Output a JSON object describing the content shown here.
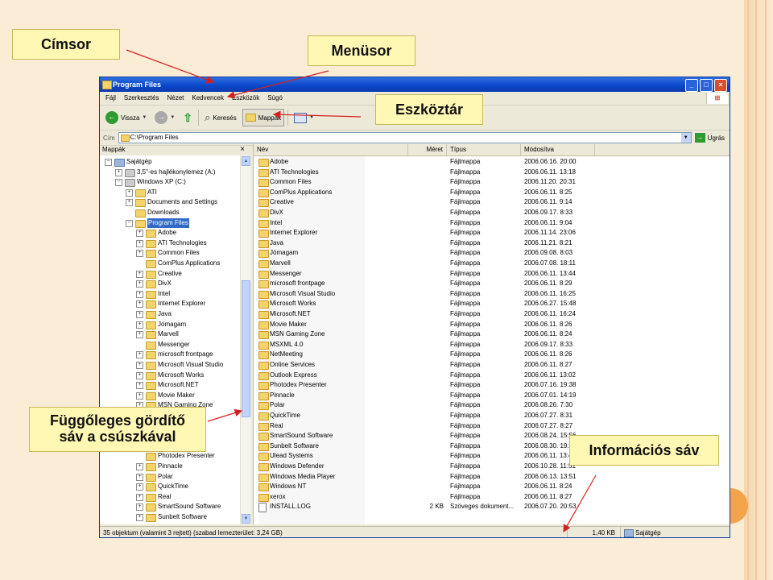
{
  "callouts": {
    "title_bar": "Címsor",
    "menu_bar": "Menüsor",
    "toolbar": "Eszköztár",
    "vertical_scroll_line1": "Függőleges gördítő",
    "vertical_scroll_line2": "sáv a csúszkával",
    "status_bar": "Információs sáv"
  },
  "window": {
    "title": "Program Files",
    "menu": [
      "Fájl",
      "Szerkesztés",
      "Nézet",
      "Kedvencek",
      "Eszközök",
      "Súgó"
    ],
    "toolbar": {
      "back": "Vissza",
      "search": "Keresés",
      "folders": "Mappák"
    },
    "address": {
      "label": "Cím",
      "value": "C:\\Program Files",
      "go": "Ugrás"
    },
    "folders_pane": {
      "title": "Mappák",
      "items": [
        {
          "label": "Sajátgép",
          "indent": 0,
          "expander": "−",
          "icon": "computer"
        },
        {
          "label": "3,5\"-es hajlékonylemez (A:)",
          "indent": 1,
          "expander": "+",
          "icon": "drive"
        },
        {
          "label": "Windows XP (C:)",
          "indent": 1,
          "expander": "−",
          "icon": "drive"
        },
        {
          "label": "ATI",
          "indent": 2,
          "expander": "+",
          "icon": "folder"
        },
        {
          "label": "Documents and Settings",
          "indent": 2,
          "expander": "+",
          "icon": "folder"
        },
        {
          "label": "Downloads",
          "indent": 2,
          "expander": "",
          "icon": "folder"
        },
        {
          "label": "Program Files",
          "indent": 2,
          "expander": "−",
          "icon": "folder",
          "selected": true
        },
        {
          "label": "Adobe",
          "indent": 3,
          "expander": "+",
          "icon": "folder"
        },
        {
          "label": "ATI Technologies",
          "indent": 3,
          "expander": "+",
          "icon": "folder"
        },
        {
          "label": "Common Files",
          "indent": 3,
          "expander": "+",
          "icon": "folder"
        },
        {
          "label": "ComPlus Applications",
          "indent": 3,
          "expander": "",
          "icon": "folder"
        },
        {
          "label": "Creative",
          "indent": 3,
          "expander": "+",
          "icon": "folder"
        },
        {
          "label": "DivX",
          "indent": 3,
          "expander": "+",
          "icon": "folder"
        },
        {
          "label": "Intel",
          "indent": 3,
          "expander": "+",
          "icon": "folder"
        },
        {
          "label": "Internet Explorer",
          "indent": 3,
          "expander": "+",
          "icon": "folder"
        },
        {
          "label": "Java",
          "indent": 3,
          "expander": "+",
          "icon": "folder"
        },
        {
          "label": "Jómagam",
          "indent": 3,
          "expander": "+",
          "icon": "folder"
        },
        {
          "label": "Marvell",
          "indent": 3,
          "expander": "+",
          "icon": "folder"
        },
        {
          "label": "Messenger",
          "indent": 3,
          "expander": "",
          "icon": "folder"
        },
        {
          "label": "microsoft frontpage",
          "indent": 3,
          "expander": "+",
          "icon": "folder"
        },
        {
          "label": "Microsoft Visual Studio",
          "indent": 3,
          "expander": "+",
          "icon": "folder"
        },
        {
          "label": "Microsoft Works",
          "indent": 3,
          "expander": "+",
          "icon": "folder"
        },
        {
          "label": "Microsoft.NET",
          "indent": 3,
          "expander": "+",
          "icon": "folder"
        },
        {
          "label": "Movie Maker",
          "indent": 3,
          "expander": "+",
          "icon": "folder"
        },
        {
          "label": "MSN Gaming Zone",
          "indent": 3,
          "expander": "+",
          "icon": "folder"
        },
        {
          "label": "MSXML 4.0",
          "indent": 3,
          "expander": "+",
          "icon": "folder"
        },
        {
          "label": "NetMeeting",
          "indent": 3,
          "expander": "+",
          "icon": "folder"
        },
        {
          "label": "Online Services",
          "indent": 3,
          "expander": "+",
          "icon": "folder"
        },
        {
          "label": "Outlook Express",
          "indent": 3,
          "expander": "+",
          "icon": "folder"
        },
        {
          "label": "Photodex Presenter",
          "indent": 3,
          "expander": "",
          "icon": "folder"
        },
        {
          "label": "Pinnacle",
          "indent": 3,
          "expander": "+",
          "icon": "folder"
        },
        {
          "label": "Polar",
          "indent": 3,
          "expander": "+",
          "icon": "folder"
        },
        {
          "label": "QuickTime",
          "indent": 3,
          "expander": "+",
          "icon": "folder"
        },
        {
          "label": "Real",
          "indent": 3,
          "expander": "+",
          "icon": "folder"
        },
        {
          "label": "SmartSound Software",
          "indent": 3,
          "expander": "+",
          "icon": "folder"
        },
        {
          "label": "Sunbelt Software",
          "indent": 3,
          "expander": "+",
          "icon": "folder"
        }
      ]
    },
    "file_list": {
      "columns": {
        "name": "Név",
        "size": "Méret",
        "type": "Típus",
        "modified": "Módosítva"
      },
      "rows": [
        {
          "name": "Adobe",
          "size": "",
          "type": "Fájlmappa",
          "modified": "2006.06.16. 20:00"
        },
        {
          "name": "ATI Technologies",
          "size": "",
          "type": "Fájlmappa",
          "modified": "2006.06.11. 13:18"
        },
        {
          "name": "Common Files",
          "size": "",
          "type": "Fájlmappa",
          "modified": "2006.11.20. 20:31"
        },
        {
          "name": "ComPlus Applications",
          "size": "",
          "type": "Fájlmappa",
          "modified": "2006.06.11. 8:25"
        },
        {
          "name": "Creative",
          "size": "",
          "type": "Fájlmappa",
          "modified": "2006.06.11. 9:14"
        },
        {
          "name": "DivX",
          "size": "",
          "type": "Fájlmappa",
          "modified": "2006.09.17. 8:33"
        },
        {
          "name": "Intel",
          "size": "",
          "type": "Fájlmappa",
          "modified": "2006.06.11. 9:04"
        },
        {
          "name": "Internet Explorer",
          "size": "",
          "type": "Fájlmappa",
          "modified": "2006.11.14. 23:06"
        },
        {
          "name": "Java",
          "size": "",
          "type": "Fájlmappa",
          "modified": "2006.11.21. 8:21"
        },
        {
          "name": "Jómagam",
          "size": "",
          "type": "Fájlmappa",
          "modified": "2006.09.08. 8:03"
        },
        {
          "name": "Marvell",
          "size": "",
          "type": "Fájlmappa",
          "modified": "2006.07.08. 18:11"
        },
        {
          "name": "Messenger",
          "size": "",
          "type": "Fájlmappa",
          "modified": "2006.06.11. 13:44"
        },
        {
          "name": "microsoft frontpage",
          "size": "",
          "type": "Fájlmappa",
          "modified": "2006.06.11. 8:29"
        },
        {
          "name": "Microsoft Visual Studio",
          "size": "",
          "type": "Fájlmappa",
          "modified": "2006.06.11. 16:25"
        },
        {
          "name": "Microsoft Works",
          "size": "",
          "type": "Fájlmappa",
          "modified": "2006.06.27. 15:48"
        },
        {
          "name": "Microsoft.NET",
          "size": "",
          "type": "Fájlmappa",
          "modified": "2006.06.11. 16:24"
        },
        {
          "name": "Movie Maker",
          "size": "",
          "type": "Fájlmappa",
          "modified": "2006.06.11. 8:26"
        },
        {
          "name": "MSN Gaming Zone",
          "size": "",
          "type": "Fájlmappa",
          "modified": "2006.06.11. 8:24"
        },
        {
          "name": "MSXML 4.0",
          "size": "",
          "type": "Fájlmappa",
          "modified": "2006.09.17. 8:33"
        },
        {
          "name": "NetMeeting",
          "size": "",
          "type": "Fájlmappa",
          "modified": "2006.06.11. 8:26"
        },
        {
          "name": "Online Services",
          "size": "",
          "type": "Fájlmappa",
          "modified": "2006.06.11. 8:27"
        },
        {
          "name": "Outlook Express",
          "size": "",
          "type": "Fájlmappa",
          "modified": "2006.06.11. 13:02"
        },
        {
          "name": "Photodex Presenter",
          "size": "",
          "type": "Fájlmappa",
          "modified": "2006.07.16. 19:38"
        },
        {
          "name": "Pinnacle",
          "size": "",
          "type": "Fájlmappa",
          "modified": "2006.07.01. 14:19"
        },
        {
          "name": "Polar",
          "size": "",
          "type": "Fájlmappa",
          "modified": "2006.08.26. 7:30"
        },
        {
          "name": "QuickTime",
          "size": "",
          "type": "Fájlmappa",
          "modified": "2006.07.27. 8:31"
        },
        {
          "name": "Real",
          "size": "",
          "type": "Fájlmappa",
          "modified": "2006.07.27. 8:27"
        },
        {
          "name": "SmartSound Software",
          "size": "",
          "type": "Fájlmappa",
          "modified": "2006.08.24. 15:56"
        },
        {
          "name": "Sunbelt Software",
          "size": "",
          "type": "Fájlmappa",
          "modified": "2006.08.30. 19:06"
        },
        {
          "name": "Ulead Systems",
          "size": "",
          "type": "Fájlmappa",
          "modified": "2006.06.11. 13:42"
        },
        {
          "name": "Windows Defender",
          "size": "",
          "type": "Fájlmappa",
          "modified": "2006.10.28. 11:51"
        },
        {
          "name": "Windows Media Player",
          "size": "",
          "type": "Fájlmappa",
          "modified": "2006.06.13. 13:51"
        },
        {
          "name": "Windows NT",
          "size": "",
          "type": "Fájlmappa",
          "modified": "2006.06.11. 8:24"
        },
        {
          "name": "xerox",
          "size": "",
          "type": "Fájlmappa",
          "modified": "2006.06.11. 8:27"
        },
        {
          "name": "INSTALL.LOG",
          "size": "2 KB",
          "type": "Szöveges dokument...",
          "modified": "2006.07.20. 20:53",
          "icon": "file"
        }
      ]
    },
    "status": {
      "objects": "35 objektum (valamint 3 rejtett) (szabad lemezterület: 3,24 GB)",
      "size": "1,40 KB",
      "location": "Sajátgép"
    }
  }
}
